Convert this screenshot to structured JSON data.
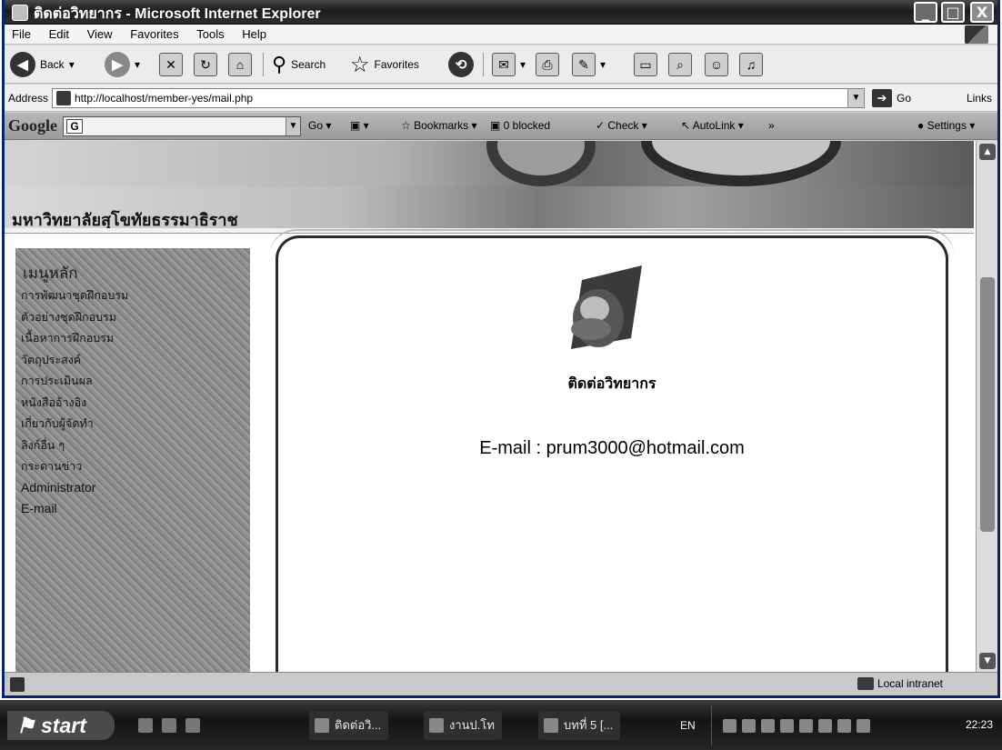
{
  "window": {
    "title": "ติดต่อวิทยากร - Microsoft Internet Explorer",
    "controls": {
      "minimize": "_",
      "maximize": "□",
      "close": "X"
    }
  },
  "menubar": [
    "File",
    "Edit",
    "View",
    "Favorites",
    "Tools",
    "Help"
  ],
  "toolbar": {
    "back_label": "Back",
    "search_label": "Search",
    "favorites_label": "Favorites"
  },
  "addressbar": {
    "label": "Address",
    "url": "http://localhost/member-yes/mail.php",
    "go_label": "Go",
    "links_label": "Links"
  },
  "googlebar": {
    "logo": "Google",
    "go_label": "Go",
    "bookmarks_label": "Bookmarks",
    "blocked_label": "0 blocked",
    "check_label": "Check",
    "autolink_label": "AutoLink",
    "settings_label": "Settings"
  },
  "page": {
    "site_title": "มหาวิทยาลัยสุโขทัยธรรมาธิราช",
    "sidebar": {
      "title": "เมนูหลัก",
      "items": [
        "การพัฒนาชุดฝึกอบรม",
        "ตัวอย่างชุดฝึกอบรม",
        "เนื้อหาการฝึกอบรม",
        "วัตถุประสงค์",
        "การประเมินผล",
        "หนังสืออ้างอิง",
        "เกี่ยวกับผู้จัดทำ",
        "ลิงก์อื่น ๆ",
        "กระดานข่าว",
        "Administrator",
        "E-mail"
      ]
    },
    "panel": {
      "heading": "ติดต่อวิทยากร",
      "email_line": "E-mail : prum3000@hotmail.com"
    }
  },
  "statusbar": {
    "zone": "Local intranet"
  },
  "taskbar": {
    "start_label": "start",
    "tasks": [
      "ติดต่อวิ...",
      "งานป.โท",
      "บทที่ 5 [..."
    ],
    "language": "EN",
    "clock": "22:23"
  }
}
